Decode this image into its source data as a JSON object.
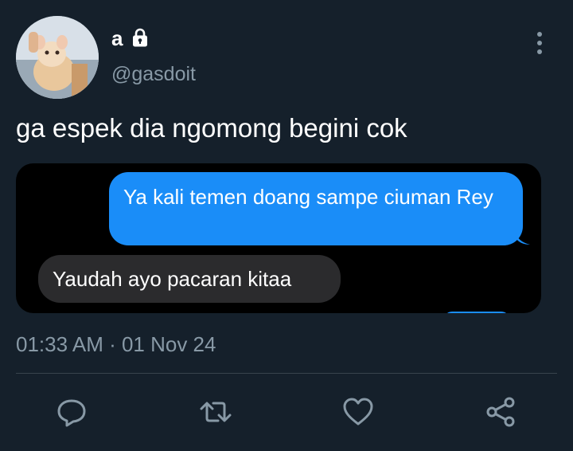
{
  "user": {
    "display_name": "a",
    "handle": "@gasdoit",
    "locked_icon": "lock-icon",
    "avatar_icon": "avatar-photo"
  },
  "tweet": {
    "text": "ga espek dia ngomong begini cok",
    "timestamp": "01:33 AM · 01 Nov 24"
  },
  "media": {
    "messages": [
      {
        "side": "sent",
        "text": "Ya kali temen doang sampe ciuman Rey"
      },
      {
        "side": "received",
        "text": "Yaudah ayo pacaran kitaa"
      }
    ]
  },
  "actions": [
    {
      "name": "reply",
      "icon": "reply-icon"
    },
    {
      "name": "retweet",
      "icon": "retweet-icon"
    },
    {
      "name": "like",
      "icon": "heart-icon"
    },
    {
      "name": "share",
      "icon": "share-icon"
    }
  ],
  "colors": {
    "background": "#15202b",
    "secondary_text": "#8899a6",
    "sent_bubble": "#1a8df8",
    "received_bubble": "#2b2b2d",
    "divider": "#38444d"
  }
}
